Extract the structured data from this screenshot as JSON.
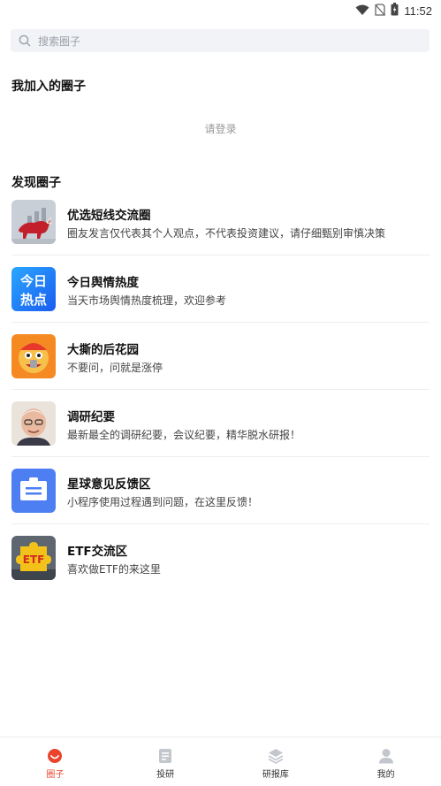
{
  "status_bar": {
    "time": "11:52",
    "icons": [
      "wifi-icon",
      "no-sim-icon",
      "battery-icon"
    ]
  },
  "search": {
    "placeholder": "搜索圈子"
  },
  "joined": {
    "title": "我加入的圈子",
    "login_prompt": "请登录"
  },
  "discover": {
    "title": "发现圈子",
    "circles": [
      {
        "name": "优选短线交流圈",
        "desc": "圈友发言仅代表其个人观点，不代表投资建议，请仔细甄别审慎决策",
        "icon": "bull-market-icon"
      },
      {
        "name": "今日舆情热度",
        "desc": "当天市场舆情热度梳理，欢迎参考",
        "icon": "today-hot-icon",
        "icon_text": [
          "今日",
          "热点"
        ]
      },
      {
        "name": "大撕的后花园",
        "desc": "不要问，问就是涨停",
        "icon": "lion-dance-icon"
      },
      {
        "name": "调研纪要",
        "desc": "最新最全的调研纪要，会议纪要，精华脱水研报！",
        "icon": "portrait-icon"
      },
      {
        "name": "星球意见反馈区",
        "desc": "小程序使用过程遇到问题，在这里反馈！",
        "icon": "feedback-icon"
      },
      {
        "name": "ETF交流区",
        "desc": "喜欢做ETF的来这里",
        "icon": "etf-puzzle-icon",
        "icon_text": [
          "ETF"
        ]
      }
    ]
  },
  "tabbar": {
    "active_color": "#e8452c",
    "tabs": [
      {
        "label": "圈子",
        "icon": "circle-icon",
        "active": true
      },
      {
        "label": "投研",
        "icon": "document-icon",
        "active": false
      },
      {
        "label": "研报库",
        "icon": "layers-icon",
        "active": false
      },
      {
        "label": "我的",
        "icon": "user-icon",
        "active": false
      }
    ]
  }
}
